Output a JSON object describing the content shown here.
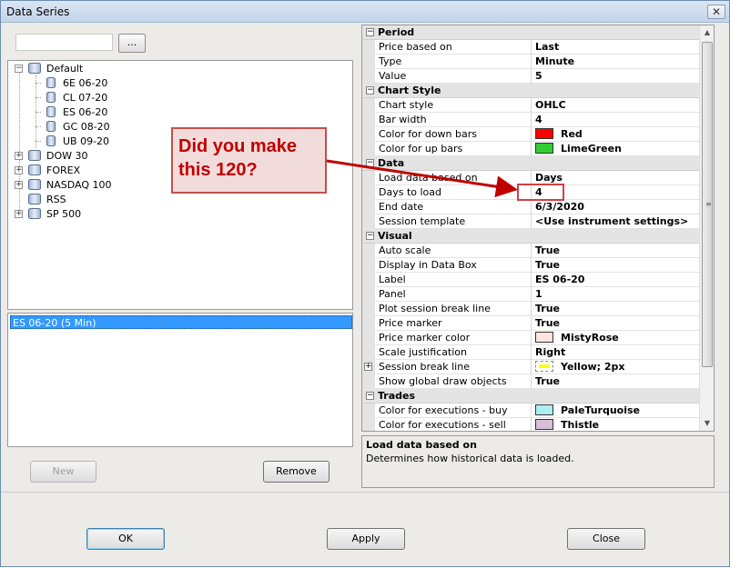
{
  "window": {
    "title": "Data Series",
    "close_glyph": "✕"
  },
  "instrument_search": {
    "value": "",
    "browse_label": "..."
  },
  "tree": {
    "default_group": "Default",
    "default_items": [
      "6E 06-20",
      "CL 07-20",
      "ES 06-20",
      "GC 08-20",
      "UB 09-20"
    ],
    "other_groups": [
      "DOW 30",
      "FOREX",
      "NASDAQ 100",
      "RSS",
      "SP 500"
    ]
  },
  "series_list": {
    "items": [
      "ES 06-20 (5 Min)"
    ]
  },
  "buttons": {
    "new": "New",
    "remove": "Remove",
    "ok": "OK",
    "apply": "Apply",
    "close": "Close"
  },
  "properties": {
    "categories": {
      "period": "Period",
      "chart_style": "Chart Style",
      "data": "Data",
      "visual": "Visual",
      "trades": "Trades"
    },
    "period": {
      "price_based_on": {
        "name": "Price based on",
        "value": "Last"
      },
      "type": {
        "name": "Type",
        "value": "Minute"
      },
      "value": {
        "name": "Value",
        "value": "5"
      }
    },
    "chart_style": {
      "chart_style": {
        "name": "Chart style",
        "value": "OHLC"
      },
      "bar_width": {
        "name": "Bar width",
        "value": "4"
      },
      "down_color": {
        "name": "Color for down bars",
        "value": "Red",
        "swatch": "#ff0000"
      },
      "up_color": {
        "name": "Color for up bars",
        "value": "LimeGreen",
        "swatch": "#32cd32"
      }
    },
    "data": {
      "load_based_on": {
        "name": "Load data based on",
        "value": "Days"
      },
      "days_to_load": {
        "name": "Days to load",
        "value": "4"
      },
      "end_date": {
        "name": "End date",
        "value": "6/3/2020"
      },
      "session_template": {
        "name": "Session template",
        "value": "<Use instrument settings>"
      }
    },
    "visual": {
      "auto_scale": {
        "name": "Auto scale",
        "value": "True"
      },
      "display_in_data_box": {
        "name": "Display in Data Box",
        "value": "True"
      },
      "label": {
        "name": "Label",
        "value": "ES 06-20"
      },
      "panel": {
        "name": "Panel",
        "value": "1"
      },
      "plot_session_break": {
        "name": "Plot session break line",
        "value": "True"
      },
      "price_marker": {
        "name": "Price marker",
        "value": "True"
      },
      "price_marker_color": {
        "name": "Price marker color",
        "value": "MistyRose",
        "swatch": "#ffe4e1"
      },
      "scale_justification": {
        "name": "Scale justification",
        "value": "Right"
      },
      "session_break_line": {
        "name": "Session break line",
        "value": "Yellow; 2px",
        "swatch": "#ffff00"
      },
      "show_global_draw": {
        "name": "Show global draw objects",
        "value": "True"
      }
    },
    "trades": {
      "exec_buy": {
        "name": "Color for executions - buy",
        "value": "PaleTurquoise",
        "swatch": "#afeeee"
      },
      "exec_sell": {
        "name": "Color for executions - sell",
        "value": "Thistle",
        "swatch": "#d8bfd8"
      }
    }
  },
  "description": {
    "title": "Load data based on",
    "text": "Determines how historical data is loaded."
  },
  "annotation": {
    "line1": "Did you make",
    "line2": "this 120?",
    "color": "#c00000"
  }
}
